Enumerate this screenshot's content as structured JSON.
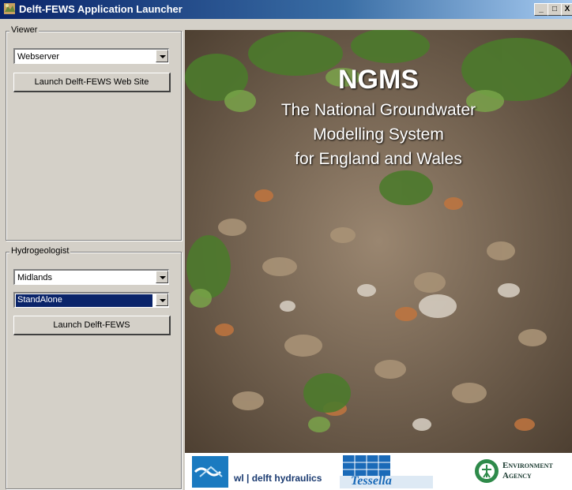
{
  "window": {
    "title": "Delft-FEWS Application Launcher",
    "min_label": "_",
    "max_label": "□",
    "close_label": "X"
  },
  "viewer": {
    "legend": "Viewer",
    "combo_value": "Webserver",
    "launch_label": "Launch Delft-FEWS Web Site"
  },
  "hydrogeologist": {
    "legend": "Hydrogeologist",
    "region_value": "Midlands",
    "mode_value": "StandAlone",
    "launch_label": "Launch Delft-FEWS"
  },
  "splash": {
    "headline": "NGMS",
    "line1": "The National Groundwater",
    "line2": "Modelling System",
    "line3": "for England and Wales"
  },
  "logos": {
    "wl_text": "wl | delft hydraulics",
    "tessella_text": "Tessella",
    "ea_line1": "Environment",
    "ea_line2": "Agency"
  },
  "colors": {
    "title_bar": "#0a246a",
    "selection": "#0a246a",
    "face": "#d4d0c8"
  }
}
